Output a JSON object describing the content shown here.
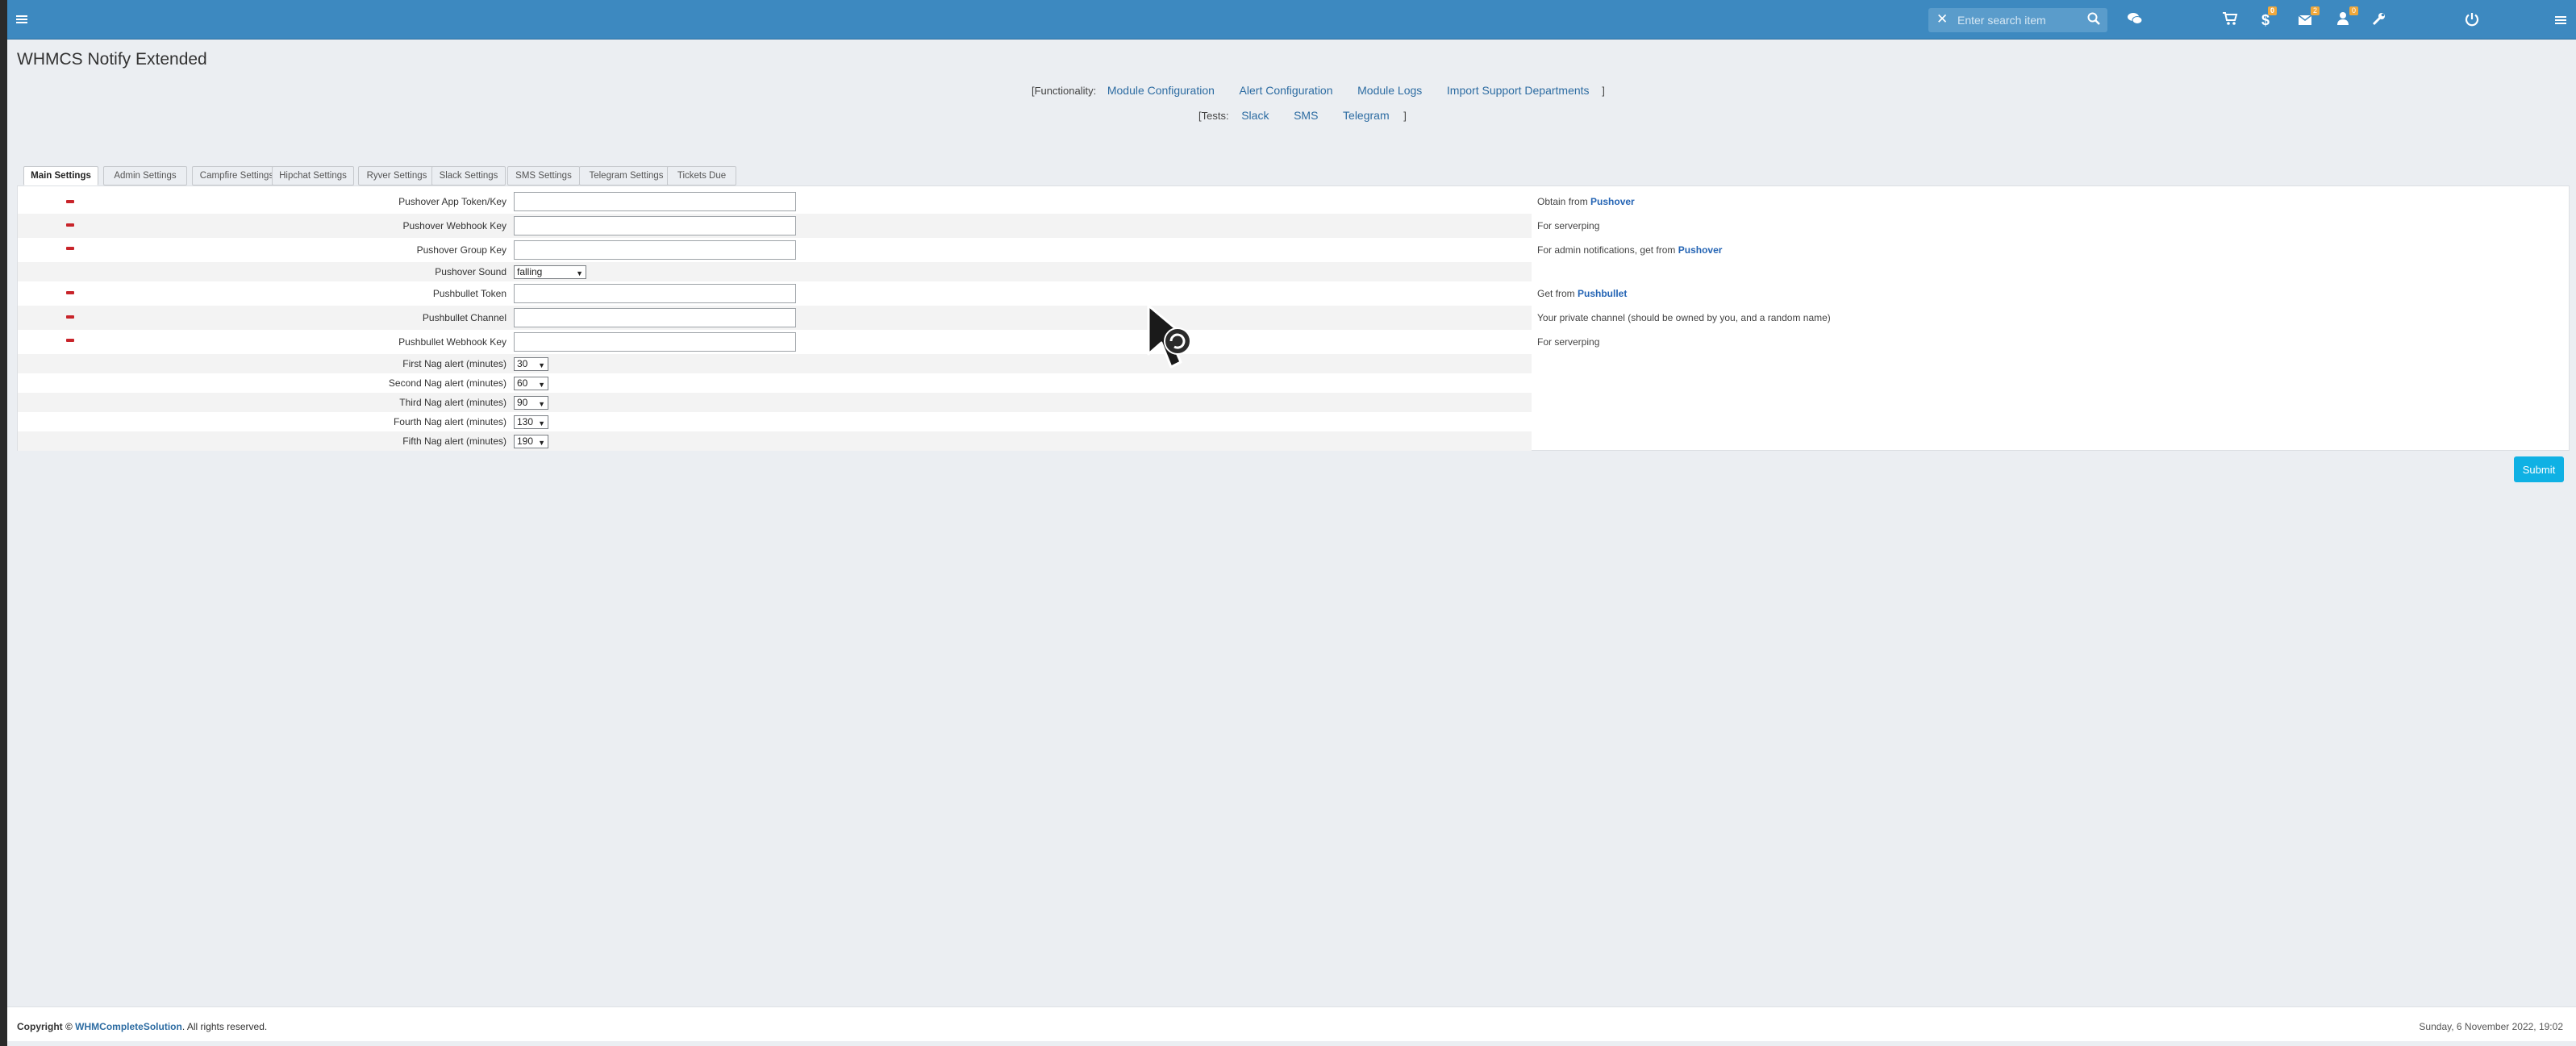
{
  "topbar": {
    "search_placeholder": "Enter search item",
    "icons": [
      "menu-icon",
      "close-icon",
      "search-icon",
      "chat-icon",
      "cart-icon",
      "dollar-icon",
      "mail-icon",
      "user-alert-icon",
      "wrench-icon",
      "power-icon",
      "menu-icon"
    ],
    "badges": {
      "dollar": "0",
      "mail": "2",
      "user": "0"
    },
    "accent_color": "#3d89c0"
  },
  "page": {
    "title": "WHMCS Notify Extended"
  },
  "functionality": {
    "prefix": "[Functionality:",
    "links": [
      "Module Configuration",
      "Alert Configuration",
      "Module Logs",
      "Import Support Departments"
    ],
    "suffix": "]"
  },
  "tests": {
    "prefix": "[Tests:",
    "links": [
      "Slack",
      "SMS",
      "Telegram"
    ],
    "suffix": "]"
  },
  "tabs": [
    "Main Settings",
    "Admin Settings",
    "Campfire Settings",
    "Hipchat Settings",
    "Ryver Settings",
    "Slack Settings",
    "SMS Settings",
    "Telegram Settings",
    "Tickets Due"
  ],
  "active_tab": "Main Settings",
  "settings": [
    {
      "label": "Pushover App Token/Key",
      "type": "text",
      "value": "",
      "required": true,
      "note_prefix": "Obtain from ",
      "note_link": "Pushover"
    },
    {
      "label": "Pushover Webhook Key",
      "type": "text",
      "value": "",
      "required": true,
      "note_prefix": "For serverping",
      "note_link": ""
    },
    {
      "label": "Pushover Group Key",
      "type": "text",
      "value": "",
      "required": true,
      "note_prefix": "For admin notifications, get from ",
      "note_link": "Pushover"
    },
    {
      "label": "Pushover Sound",
      "type": "select",
      "value": "falling",
      "required": false,
      "note_prefix": "",
      "note_link": ""
    },
    {
      "label": "Pushbullet Token",
      "type": "text",
      "value": "",
      "required": true,
      "note_prefix": "Get from ",
      "note_link": "Pushbullet"
    },
    {
      "label": "Pushbullet Channel",
      "type": "text",
      "value": "",
      "required": true,
      "note_prefix": "Your private channel (should be owned by you, and a random name)",
      "note_link": ""
    },
    {
      "label": "Pushbullet Webhook Key",
      "type": "text",
      "value": "",
      "required": true,
      "note_prefix": "For serverping",
      "note_link": ""
    },
    {
      "label": "First Nag alert (minutes)",
      "type": "select",
      "value": "30",
      "required": false,
      "note_prefix": "",
      "note_link": ""
    },
    {
      "label": "Second Nag alert (minutes)",
      "type": "select",
      "value": "60",
      "required": false,
      "note_prefix": "",
      "note_link": ""
    },
    {
      "label": "Third Nag alert (minutes)",
      "type": "select",
      "value": "90",
      "required": false,
      "note_prefix": "",
      "note_link": ""
    },
    {
      "label": "Fourth Nag alert (minutes)",
      "type": "select",
      "value": "130",
      "required": false,
      "note_prefix": "",
      "note_link": ""
    },
    {
      "label": "Fifth Nag alert (minutes)",
      "type": "select",
      "value": "190",
      "required": false,
      "note_prefix": "",
      "note_link": ""
    }
  ],
  "submit_label": "Submit",
  "footer": {
    "copyright_prefix": "Copyright © ",
    "company": "WHMCompleteSolution",
    "copyright_suffix": ". All rights reserved.",
    "date": "Sunday, 6 November 2022, 19:02"
  }
}
